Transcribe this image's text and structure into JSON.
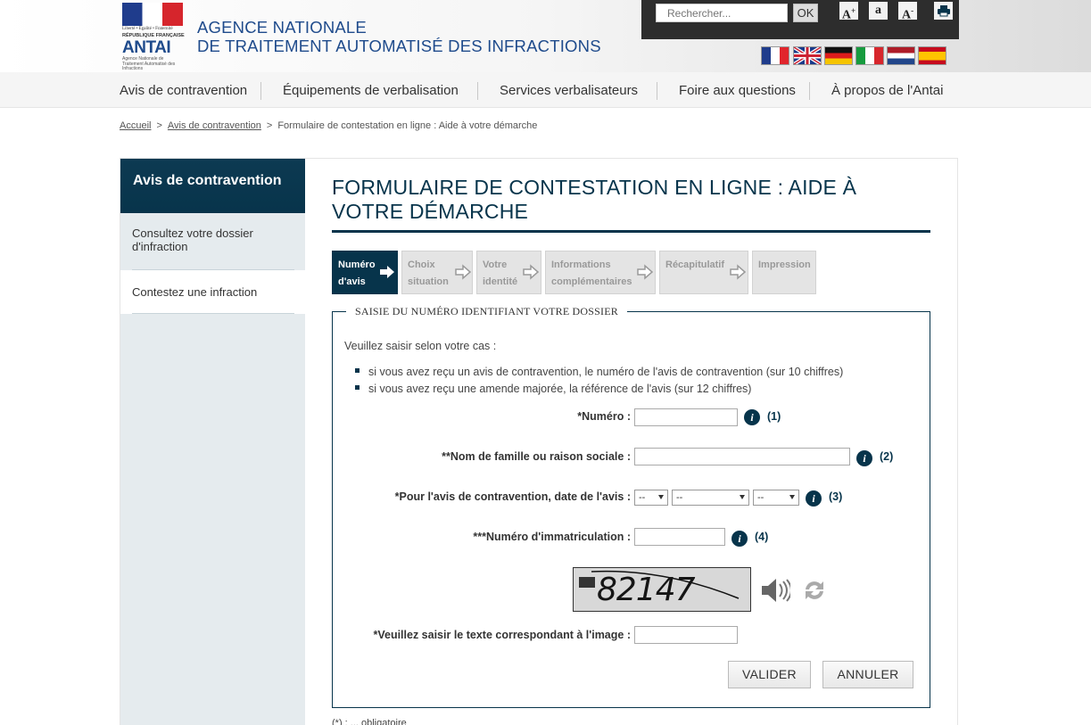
{
  "header": {
    "logo": {
      "motto": "Liberté • Égalité • Fraternité",
      "republic": "RÉPUBLIQUE FRANÇAISE",
      "brand": "ANTAI",
      "brand_sub": "Agence Nationale de Traitement Automatisé des Infractions"
    },
    "agency_line1": "AGENCE NATIONALE",
    "agency_line2": "DE TRAITEMENT AUTOMATISÉ DES INFRACTIONS",
    "search_placeholder": "Rechercher...",
    "search_button": "OK",
    "font_increase": "A+",
    "font_normal": "a",
    "font_decrease": "A-",
    "print_icon": "print-icon",
    "languages": [
      "fr-flag",
      "en-flag",
      "de-flag",
      "it-flag",
      "nl-flag",
      "es-flag"
    ]
  },
  "nav": [
    "Avis de contravention",
    "Équipements de verbalisation",
    "Services verbalisateurs",
    "Foire aux questions",
    "À propos de l'Antai"
  ],
  "breadcrumb": {
    "home": "Accueil",
    "section": "Avis de contravention",
    "current": "Formulaire de contestation en ligne : Aide à votre démarche"
  },
  "sidebar": {
    "title": "Avis de contravention",
    "items": [
      "Consultez votre dossier d'infraction",
      "Contestez une infraction"
    ]
  },
  "main": {
    "title": "FORMULAIRE DE CONTESTATION EN LIGNE : AIDE À VOTRE DÉMARCHE",
    "steps": [
      {
        "line1": "Numéro",
        "line2": "d'avis"
      },
      {
        "line1": "Choix",
        "line2": "situation"
      },
      {
        "line1": "Votre",
        "line2": "identité"
      },
      {
        "line1": "Informations",
        "line2": "complémentaires"
      },
      {
        "line1": "Récapitulatif",
        "line2": ""
      },
      {
        "line1": "Impression",
        "line2": ""
      }
    ],
    "legend": "SAISIE DU NUMÉRO IDENTIFIANT VOTRE DOSSIER",
    "intro": "Veuillez saisir selon votre cas :",
    "bullets": [
      "si vous avez reçu un avis de contravention, le numéro de l'avis de contravention (sur 10 chiffres)",
      "si vous avez reçu une amende majorée, la référence de l'avis (sur 12 chiffres)"
    ],
    "fields": {
      "numero": "*Numéro :",
      "nom": "**Nom de famille ou raison sociale :",
      "date": "*Pour l'avis de contravention, date de l'avis :",
      "immat": "***Numéro d'immatriculation :",
      "captcha": "*Veuillez saisir le texte correspondant à l'image :"
    },
    "refs": [
      "(1)",
      "(2)",
      "(3)",
      "(4)"
    ],
    "date_selects": [
      "--",
      "--",
      "--"
    ],
    "captcha_text": "82147",
    "validate": "VALIDER",
    "cancel": "ANNULER",
    "footnote": "(*) : ... obligatoire"
  },
  "colors": {
    "primary": "#07344b",
    "brand_blue": "#1f4b8c"
  }
}
